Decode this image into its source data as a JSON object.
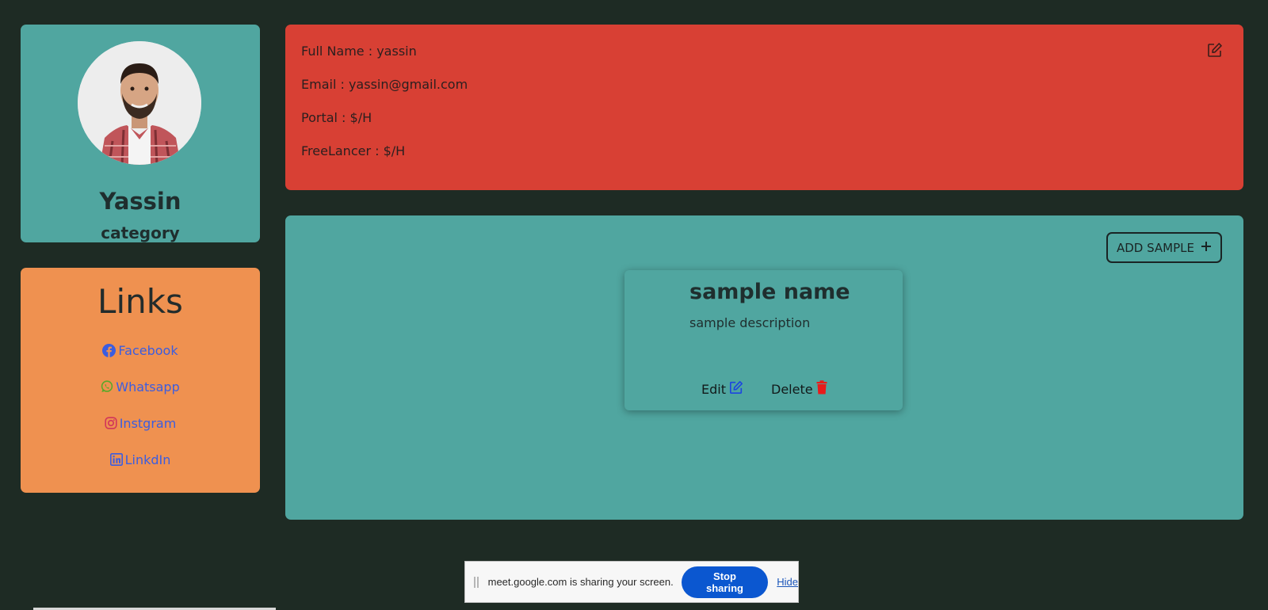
{
  "profile": {
    "name": "Yassin",
    "category": "category"
  },
  "links": {
    "title": "Links",
    "items": [
      {
        "label": "Facebook",
        "icon": "facebook-icon",
        "color": "#3b5de0"
      },
      {
        "label": "Whatsapp",
        "icon": "whatsapp-icon",
        "color": "#5aa82a"
      },
      {
        "label": "Instgram",
        "icon": "instagram-icon",
        "color": "#d1345a"
      },
      {
        "label": "LinkdIn",
        "icon": "linkedin-icon",
        "color": "#3b5de0"
      }
    ]
  },
  "info": {
    "full_name": "Full Name : yassin",
    "email": "Email : yassin@gmail.com",
    "portal": "Portal : $/H",
    "freelancer": "FreeLancer : $/H",
    "edit_icon": "edit-icon"
  },
  "samples": {
    "add_label": "ADD SAMPLE",
    "items": [
      {
        "name": "sample name",
        "description": "sample description",
        "edit_label": "Edit",
        "delete_label": "Delete"
      }
    ]
  },
  "share_bar": {
    "message": "meet.google.com is sharing your screen.",
    "stop_label": "Stop sharing",
    "hide_label": "Hide"
  },
  "colors": {
    "background": "#1e2b24",
    "teal": "#50a6a0",
    "red": "#d84034",
    "orange": "#ef9150",
    "link_blue": "#3b5de0",
    "stop_blue": "#0b57d0"
  }
}
